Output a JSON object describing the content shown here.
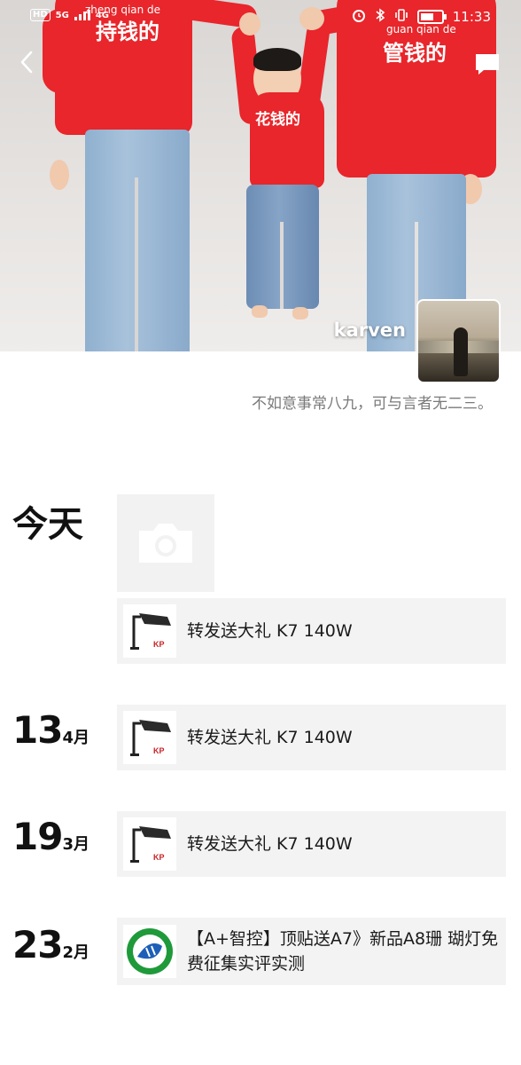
{
  "status_bar": {
    "left_indicators": [
      "HD",
      "5G",
      "4G"
    ],
    "time": "11:33",
    "icons": [
      "alarm-icon",
      "bluetooth-icon",
      "vibrate-icon",
      "battery-icon"
    ]
  },
  "cover": {
    "sweater_text_left": "持钱的",
    "sweater_text_kid": "花钱的",
    "sweater_text_right": "管钱的",
    "pinyin_left": "zheng qian de",
    "pinyin_right": "guan qian de"
  },
  "profile": {
    "username": "karven",
    "signature": "不如意事常八九，可与言者无二三。"
  },
  "feed": {
    "today_label": "今天",
    "groups": [
      {
        "day": "",
        "month": "",
        "posts": [
          {
            "text": "转发送大礼 K7 140W",
            "thumb": "k7-lamp"
          }
        ]
      },
      {
        "day": "13",
        "month": "4月",
        "posts": [
          {
            "text": "转发送大礼 K7 140W",
            "thumb": "k7-lamp"
          }
        ]
      },
      {
        "day": "19",
        "month": "3月",
        "posts": [
          {
            "text": "转发送大礼  K7 140W",
            "thumb": "k7-lamp"
          }
        ]
      },
      {
        "day": "23",
        "month": "2月",
        "posts": [
          {
            "text": "【A+智控】顶贴送A7》新品A8珊 瑚灯免费征集实评实测",
            "thumb": "a-plus-logo"
          }
        ]
      }
    ]
  },
  "colors": {
    "accent_red": "#e8262b",
    "card_bg": "#f3f3f3",
    "signature_gray": "#7a7a7a"
  }
}
